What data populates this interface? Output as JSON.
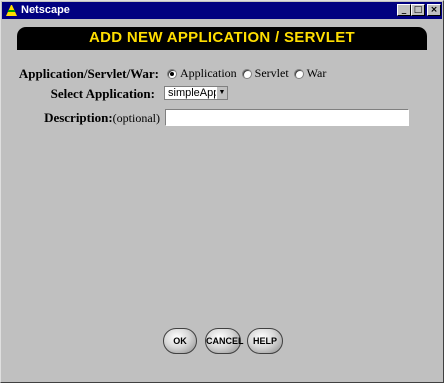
{
  "window": {
    "title": "Netscape",
    "icon": "netscape-logo-icon",
    "controls": {
      "minimize": "_",
      "maximize": "□",
      "close": "×"
    }
  },
  "banner": {
    "title": "ADD NEW APPLICATION / SERVLET"
  },
  "form": {
    "type_label": "Application/Servlet/War:",
    "type_options": [
      {
        "label": "Application",
        "checked": true
      },
      {
        "label": "Servlet",
        "checked": false
      },
      {
        "label": "War",
        "checked": false
      }
    ],
    "select_label": "Select Application:",
    "select_value": "simpleApp",
    "description_label": "Description:",
    "description_optional": "(optional)",
    "description_value": ""
  },
  "buttons": {
    "ok": "OK",
    "cancel": "CANCEL",
    "help": "HELP"
  },
  "colors": {
    "title_bar": "#000080",
    "banner_bg": "#000000",
    "banner_text": "#ffde00",
    "window_bg": "#c0c0c0"
  }
}
